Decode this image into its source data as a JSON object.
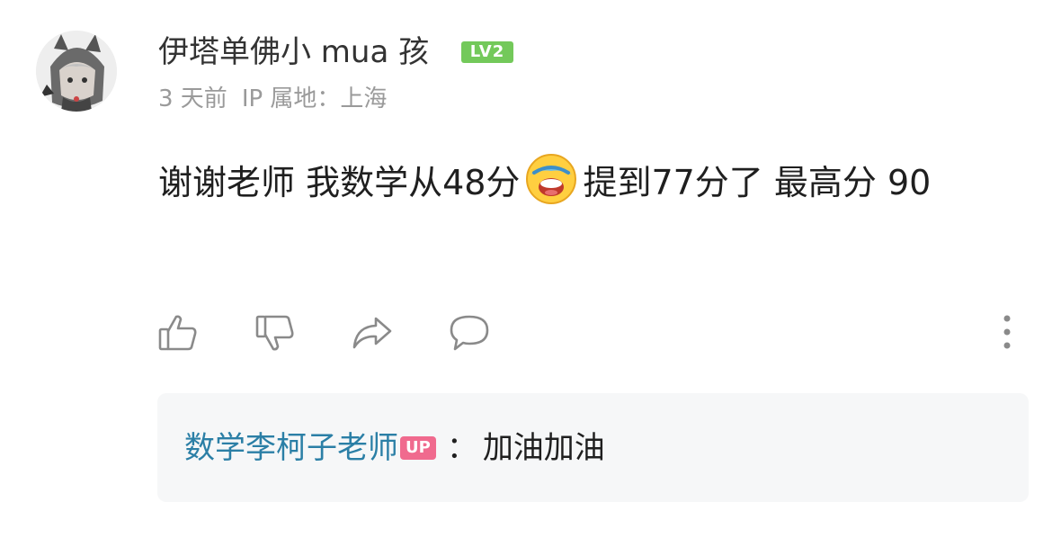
{
  "comment": {
    "username": "伊塔单佛小 mua 孩",
    "level_badge": "LV2",
    "time": "3 天前",
    "ip_location": "IP 属地：上海",
    "text_part1": "谢谢老师 我数学从48分",
    "emoji": "laughing-crying-face-emoji",
    "text_part2": "提到77分了 最高分 90"
  },
  "actions": [
    "like-icon",
    "dislike-icon",
    "share-icon",
    "comment-icon",
    "more-icon"
  ],
  "reply": {
    "author": "数学李柯子老师",
    "badge": "UP",
    "separator": "：",
    "text": "加油加油"
  },
  "colors": {
    "level_badge": "#73c95a",
    "reply_author": "#2b7fa6",
    "up_badge": "#f06a8e",
    "reply_box_bg": "#f6f7f8"
  }
}
